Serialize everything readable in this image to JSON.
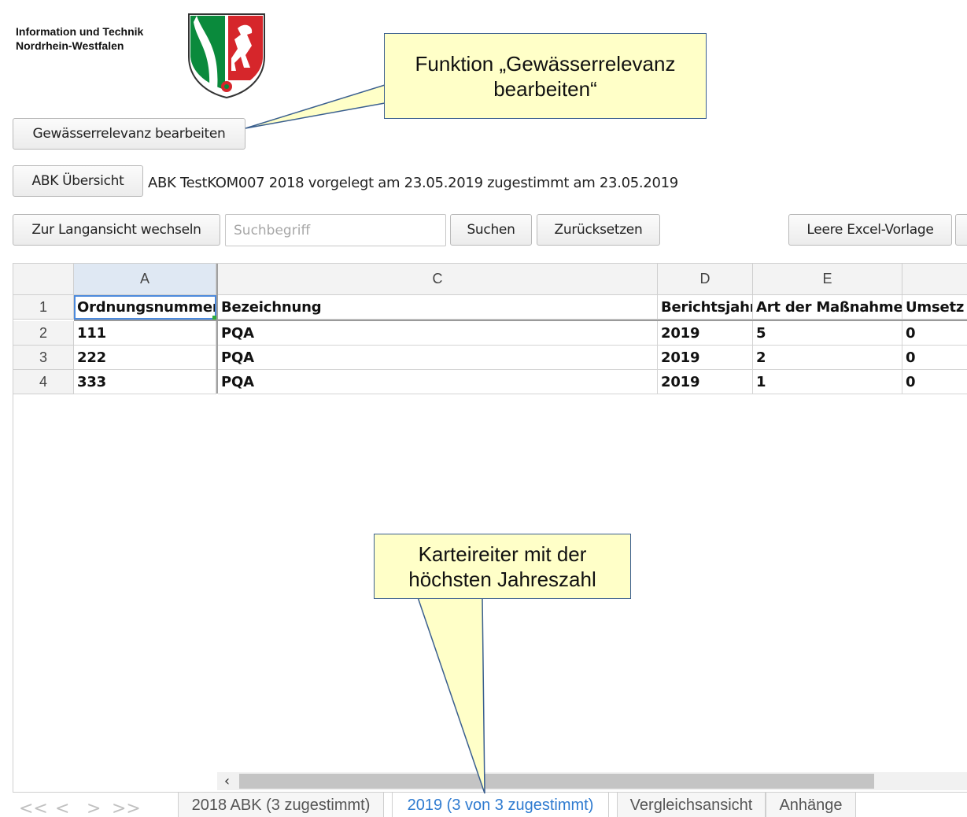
{
  "header": {
    "org_line1": "Information und Technik",
    "org_line2": "Nordrhein-Westfalen",
    "crest_colors": {
      "green": "#0a8a3c",
      "red": "#d6262b",
      "white": "#ffffff",
      "outline": "#333333"
    }
  },
  "toolbar": {
    "edit_relevance_label": "Gewässerrelevanz bearbeiten",
    "abk_overview_label": "ABK Übersicht",
    "status_text": "ABK TestKOM007 2018 vorgelegt am 23.05.2019 zugestimmt am 23.05.2019",
    "long_view_label": "Zur Langansicht wechseln",
    "search_placeholder": "Suchbegriff",
    "search_value": "",
    "search_label": "Suchen",
    "reset_label": "Zurücksetzen",
    "excel_template_label": "Leere Excel-Vorlage"
  },
  "grid": {
    "columns": [
      "A",
      "C",
      "D",
      "E",
      ""
    ],
    "rows": [
      {
        "num": "1",
        "cells": [
          "Ordnungsnummer",
          "Bezeichnung",
          "Berichtsjahr",
          "Art der Maßnahme",
          "Umsetz"
        ]
      },
      {
        "num": "2",
        "cells": [
          "111",
          "PQA",
          "2019",
          "5",
          "0"
        ]
      },
      {
        "num": "3",
        "cells": [
          "222",
          "PQA",
          "2019",
          "2",
          "0"
        ]
      },
      {
        "num": "4",
        "cells": [
          "333",
          "PQA",
          "2019",
          "1",
          "0"
        ]
      }
    ],
    "selected_cell": "A1",
    "selection_color": "#4b89dc",
    "fill_handle_color": "#2faa3c"
  },
  "scrollbar": {
    "left_arrow": "‹"
  },
  "tabs": {
    "nav_first": "<<",
    "nav_prev": "<",
    "nav_next": ">",
    "nav_last": ">>",
    "items": [
      {
        "label": "2018 ABK (3 zugestimmt)",
        "active": false
      },
      {
        "label": "2019 (3 von 3 zugestimmt)",
        "active": true
      },
      {
        "label": "Vergleichsansicht",
        "active": false
      },
      {
        "label": "Anhänge",
        "active": false
      }
    ],
    "active_color": "#2f7bd0"
  },
  "callouts": {
    "top_line1": "Funktion „Gewässerrelevanz",
    "top_line2": "bearbeiten“",
    "bottom_line1": "Karteireiter mit der",
    "bottom_line2": "höchsten Jahreszahl",
    "fill_color": "#ffffc8",
    "border_color": "#3a5f8f"
  }
}
